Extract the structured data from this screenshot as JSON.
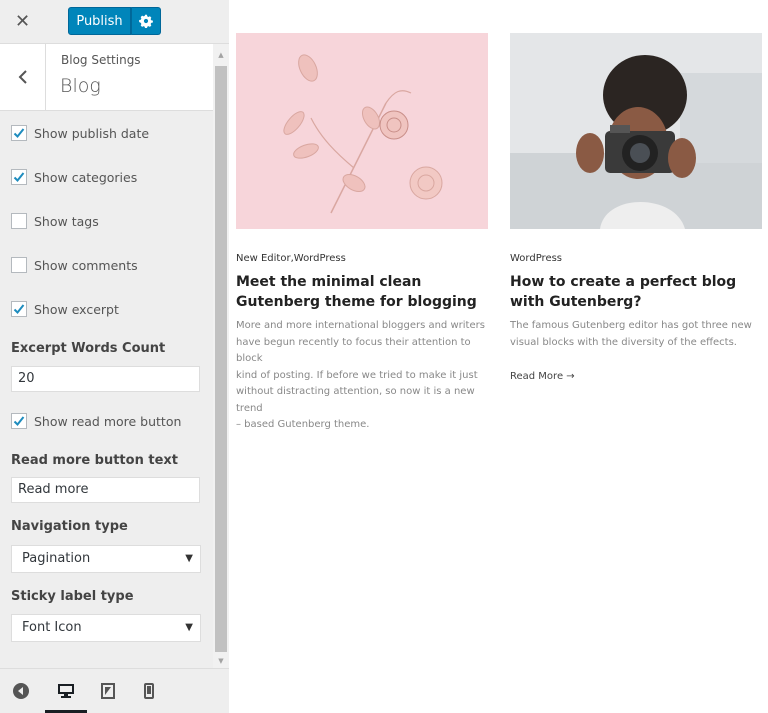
{
  "topbar": {
    "close_label": "✕",
    "publish_label": "Publish",
    "settings_icon": "gear-icon"
  },
  "section": {
    "breadcrumb": "Blog Settings",
    "title": "Blog"
  },
  "controls": {
    "show_publish_date": {
      "label": "Show publish date",
      "checked": true
    },
    "show_categories": {
      "label": "Show categories",
      "checked": true
    },
    "show_tags": {
      "label": "Show tags",
      "checked": false
    },
    "show_comments": {
      "label": "Show comments",
      "checked": false
    },
    "show_excerpt": {
      "label": "Show excerpt",
      "checked": true
    },
    "excerpt_words_label": "Excerpt Words Count",
    "excerpt_words_value": "20",
    "show_read_more": {
      "label": "Show read more button",
      "checked": true
    },
    "read_more_text_label": "Read more button text",
    "read_more_text_value": "Read more",
    "navigation_type_label": "Navigation type",
    "navigation_type_value": "Pagination",
    "sticky_label_type_label": "Sticky label type",
    "sticky_label_type_value": "Font Icon"
  },
  "footer": {
    "active_device": "desktop"
  },
  "posts": [
    {
      "category": "New Editor,WordPress",
      "title": "Meet the minimal clean Gutenberg theme for blogging",
      "excerpt": [
        "More and more international bloggers and writers",
        "have begun recently to focus their attention to block",
        "kind of posting. If before we tried to make it just",
        "without distracting attention, so now it is a new trend",
        "– based Gutenberg theme."
      ]
    },
    {
      "category": "WordPress",
      "title": "How to create a perfect blog with Gutenberg?",
      "excerpt": [
        "The famous Gutenberg editor has got three new",
        "visual blocks with the diversity of the effects."
      ],
      "read_more": "Read More →"
    }
  ],
  "colors": {
    "accent": "#0085ba",
    "checkmark": "#1e8cbe"
  }
}
